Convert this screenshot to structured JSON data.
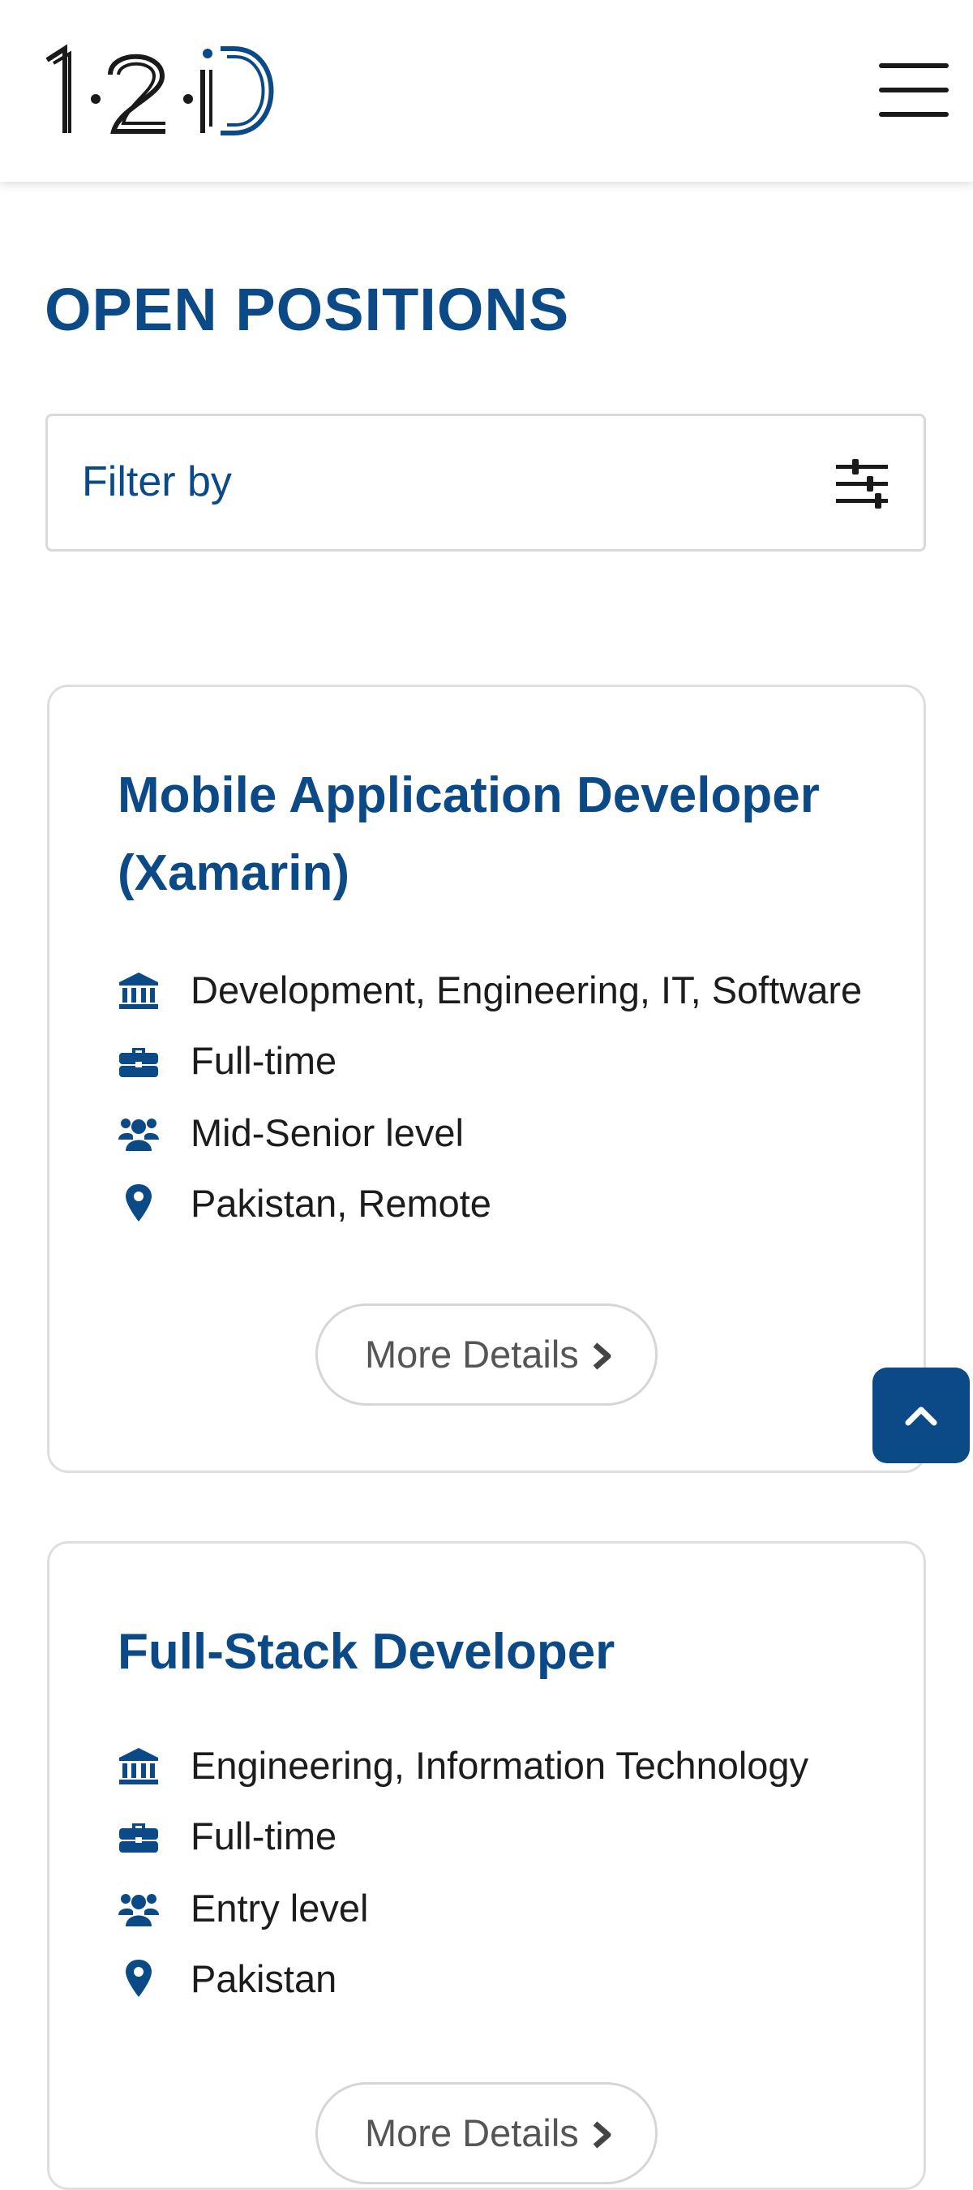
{
  "header": {
    "logo_text": "1·2·iD",
    "menu_icon": "hamburger-menu-icon"
  },
  "page": {
    "title": "OPEN POSITIONS"
  },
  "filter": {
    "label": "Filter by",
    "icon": "sliders-icon"
  },
  "jobs": [
    {
      "title": "Mobile Application Developer (Xamarin)",
      "department": "Development, Engineering, IT, Software",
      "employment_type": "Full-time",
      "level": "Mid-Senior level",
      "location": "Pakistan, Remote",
      "button_label": "More Details"
    },
    {
      "title": "Full-Stack Developer",
      "department": "Engineering, Information Technology",
      "employment_type": "Full-time",
      "level": "Entry level",
      "location": "Pakistan",
      "button_label": "More Details"
    }
  ],
  "icons": {
    "department": "bank-building-icon",
    "employment_type": "briefcase-icon",
    "level": "users-icon",
    "location": "map-pin-icon",
    "more": "chevron-right-icon",
    "back_to_top": "chevron-up-icon"
  },
  "colors": {
    "brand_blue": "#0b4a86",
    "text_dark": "#1c1c1c",
    "border_gray": "#dedede"
  }
}
